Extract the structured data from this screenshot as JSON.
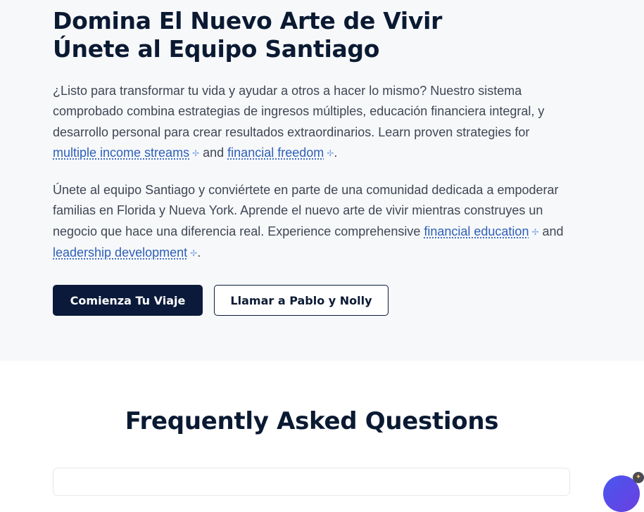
{
  "hero": {
    "title_line1": "Domina El Nuevo Arte de Vivir",
    "title_line2": "Únete al Equipo Santiago",
    "p1": {
      "text": "¿Listo para transformar tu vida y ayudar a otros a hacer lo mismo? Nuestro sistema comprobado combina estrategias de ingresos múltiples, educación financiera integral, y desarrollo personal para crear resultados extraordinarios. Learn proven strategies for ",
      "link1": "multiple income streams",
      "between": " and ",
      "link2": "financial freedom",
      "end": "."
    },
    "p2": {
      "text": "Únete al equipo Santiago y conviértete en parte de una comunidad dedicada a empoderar familias en Florida y Nueva York. Aprende el nuevo arte de vivir mientras construyes un negocio que hace una diferencia real. Experience comprehensive ",
      "link1": "financial education",
      "between": " and ",
      "link2": "leadership development",
      "end": "."
    },
    "primary_button": "Comienza Tu Viaje",
    "secondary_button": "Llamar a Pablo y Nolly"
  },
  "faq": {
    "title": "Frequently Asked Questions"
  },
  "icons": {
    "link_marker": "sparkle-icon",
    "chat": "chat-bubble-icon"
  },
  "colors": {
    "navy": "#0b1a3a",
    "link": "#2d5fb8",
    "hero_bg": "#f7f8fa",
    "fab": "#5a4ce8"
  }
}
